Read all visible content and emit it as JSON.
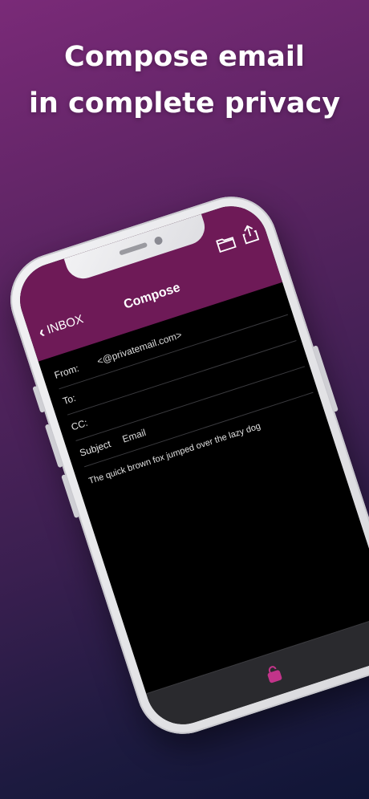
{
  "headline": {
    "line1": "Compose email",
    "line2": "in complete privacy"
  },
  "nav": {
    "back_label": "INBOX",
    "title": "Compose"
  },
  "compose": {
    "from_label": "From:",
    "from_value": "<@privatemail.com>",
    "to_label": "To:",
    "to_value": "",
    "cc_label": "CC:",
    "cc_value": "",
    "subject_label": "Subject",
    "subject_value": "Email",
    "body": "The quick brown fox jumped over the lazy dog"
  },
  "icons": {
    "header_right": [
      "folder-icon",
      "share-icon"
    ],
    "toolbar": "lock-icon"
  },
  "colors": {
    "header": "#6e1a57",
    "accent_lock": "#c2348a",
    "screen_bg": "#000000"
  }
}
